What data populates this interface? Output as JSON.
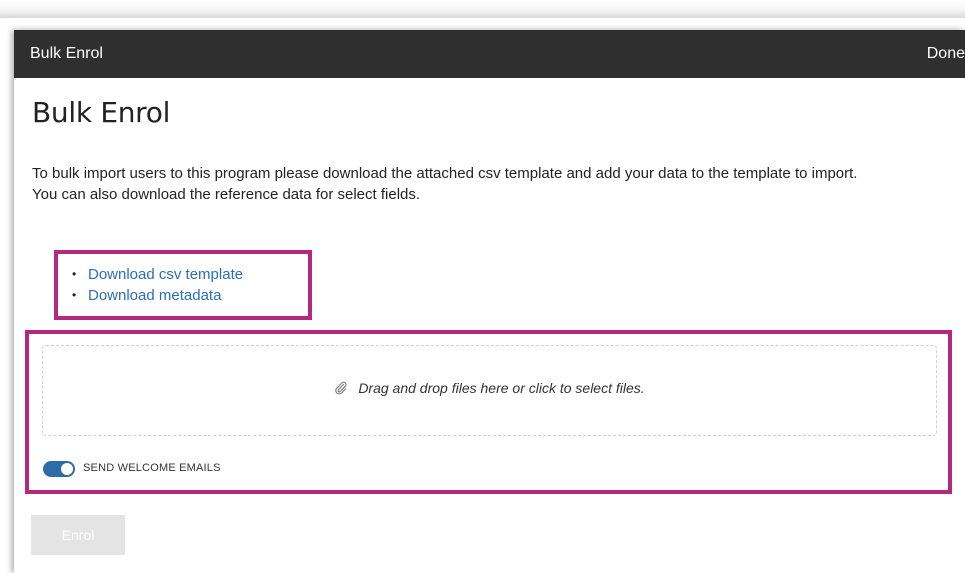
{
  "dialog": {
    "title": "Bulk Enrol",
    "done_label": "Done"
  },
  "content": {
    "heading": "Bulk Enrol",
    "description_line1": "To bulk import users to this program please download the attached csv template and add your data to the template to import.",
    "description_line2": "You can also download the reference data for select fields."
  },
  "links": [
    {
      "label": "Download csv template"
    },
    {
      "label": "Download metadata"
    }
  ],
  "upload": {
    "dropzone_text": "Drag and drop files here or click to select files.",
    "icon": "paperclip-icon",
    "welcome_emails_label": "SEND WELCOME EMAILS",
    "welcome_emails_enabled": true
  },
  "actions": {
    "enrol_label": "Enrol"
  },
  "colors": {
    "titlebar": "#2f2f2f",
    "highlight_border": "#b3297f",
    "link": "#2a6ebb",
    "toggle_on": "#2d6ca8",
    "button_disabled": "#e4e4e4"
  }
}
